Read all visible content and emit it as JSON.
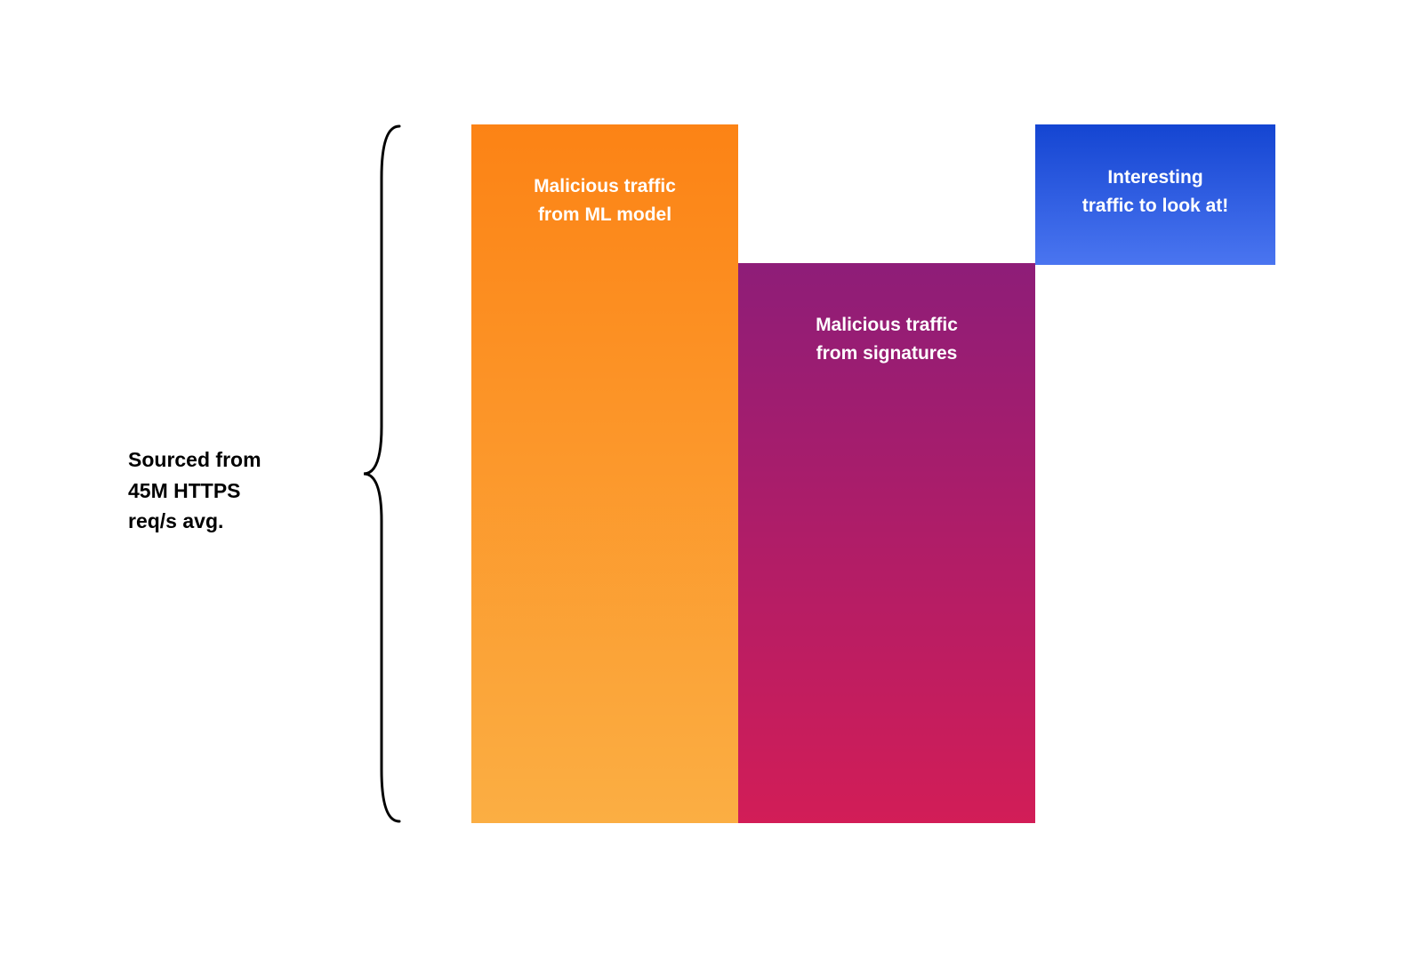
{
  "source_label": "Sourced from\n45M HTTPS\nreq/s avg.",
  "chart_data": {
    "type": "bar",
    "title": "",
    "xlabel": "",
    "ylabel": "",
    "ylim": [
      0,
      100
    ],
    "note": "Heights are relative proportions — no numeric axis shown in image",
    "series": [
      {
        "name": "Malicious traffic from ML model",
        "label": "Malicious traffic\nfrom ML model",
        "height_pct": 100,
        "color_top": "#fc8315",
        "color_bottom": "#fbae43"
      },
      {
        "name": "Malicious traffic from signatures",
        "label": "Malicious traffic\nfrom signatures",
        "height_pct": 80,
        "color_top": "#8e1d78",
        "color_bottom": "#d21d57"
      },
      {
        "name": "Interesting traffic to look at",
        "label": "Interesting\ntraffic to look at!",
        "height_pct": 20,
        "position": "top",
        "color_top": "#1445d2",
        "color_bottom": "#4a75f0"
      }
    ]
  }
}
